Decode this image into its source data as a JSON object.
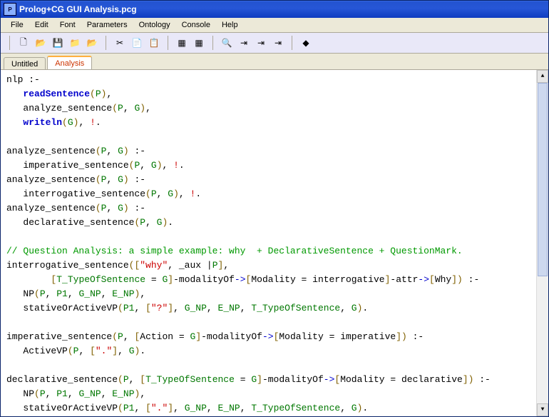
{
  "window": {
    "title": "Prolog+CG GUI Analysis.pcg",
    "app_icon_text": "P"
  },
  "menu": {
    "items": [
      "File",
      "Edit",
      "Font",
      "Parameters",
      "Ontology",
      "Console",
      "Help"
    ]
  },
  "toolbar": {
    "icons": [
      {
        "name": "new-file-icon",
        "glyph": "🗋"
      },
      {
        "name": "open-file-icon",
        "glyph": "📂"
      },
      {
        "name": "save-icon",
        "glyph": "💾"
      },
      {
        "name": "folder-plus-icon",
        "glyph": "📁"
      },
      {
        "name": "folder-open-icon",
        "glyph": "📂"
      },
      {
        "name": "sep"
      },
      {
        "name": "cut-icon",
        "glyph": "✂"
      },
      {
        "name": "copy-icon",
        "glyph": "📄"
      },
      {
        "name": "paste-icon",
        "glyph": "📋"
      },
      {
        "name": "sep"
      },
      {
        "name": "run-1-icon",
        "glyph": "▦"
      },
      {
        "name": "run-2-icon",
        "glyph": "▦"
      },
      {
        "name": "sep"
      },
      {
        "name": "find-icon",
        "glyph": "🔍"
      },
      {
        "name": "step-1-icon",
        "glyph": "⇥"
      },
      {
        "name": "step-2-icon",
        "glyph": "⇥"
      },
      {
        "name": "step-3-icon",
        "glyph": "⇥"
      },
      {
        "name": "sep"
      },
      {
        "name": "help-icon",
        "glyph": "◆"
      }
    ]
  },
  "tabs": {
    "items": [
      {
        "label": "Untitled",
        "active": false
      },
      {
        "label": "Analysis",
        "active": true
      }
    ]
  },
  "code": {
    "lines": [
      [
        {
          "t": "nlp :-",
          "c": "plain"
        }
      ],
      [
        {
          "t": "   ",
          "c": "plain"
        },
        {
          "t": "readSentence",
          "c": "kw"
        },
        {
          "t": "(",
          "c": "punc"
        },
        {
          "t": "P",
          "c": "var"
        },
        {
          "t": ")",
          "c": "punc"
        },
        {
          "t": ",",
          "c": "plain"
        }
      ],
      [
        {
          "t": "   analyze_sentence",
          "c": "plain"
        },
        {
          "t": "(",
          "c": "punc"
        },
        {
          "t": "P",
          "c": "var"
        },
        {
          "t": ", ",
          "c": "plain"
        },
        {
          "t": "G",
          "c": "var"
        },
        {
          "t": ")",
          "c": "punc"
        },
        {
          "t": ",",
          "c": "plain"
        }
      ],
      [
        {
          "t": "   ",
          "c": "plain"
        },
        {
          "t": "writeln",
          "c": "kw"
        },
        {
          "t": "(",
          "c": "punc"
        },
        {
          "t": "G",
          "c": "var"
        },
        {
          "t": ")",
          "c": "punc"
        },
        {
          "t": ", ",
          "c": "plain"
        },
        {
          "t": "!",
          "c": "str"
        },
        {
          "t": ".",
          "c": "plain"
        }
      ],
      [
        {
          "t": "",
          "c": "plain"
        }
      ],
      [
        {
          "t": "analyze_sentence",
          "c": "plain"
        },
        {
          "t": "(",
          "c": "punc"
        },
        {
          "t": "P",
          "c": "var"
        },
        {
          "t": ", ",
          "c": "plain"
        },
        {
          "t": "G",
          "c": "var"
        },
        {
          "t": ")",
          "c": "punc"
        },
        {
          "t": " :-",
          "c": "plain"
        }
      ],
      [
        {
          "t": "   imperative_sentence",
          "c": "plain"
        },
        {
          "t": "(",
          "c": "punc"
        },
        {
          "t": "P",
          "c": "var"
        },
        {
          "t": ", ",
          "c": "plain"
        },
        {
          "t": "G",
          "c": "var"
        },
        {
          "t": ")",
          "c": "punc"
        },
        {
          "t": ", ",
          "c": "plain"
        },
        {
          "t": "!",
          "c": "str"
        },
        {
          "t": ".",
          "c": "plain"
        }
      ],
      [
        {
          "t": "analyze_sentence",
          "c": "plain"
        },
        {
          "t": "(",
          "c": "punc"
        },
        {
          "t": "P",
          "c": "var"
        },
        {
          "t": ", ",
          "c": "plain"
        },
        {
          "t": "G",
          "c": "var"
        },
        {
          "t": ")",
          "c": "punc"
        },
        {
          "t": " :-",
          "c": "plain"
        }
      ],
      [
        {
          "t": "   interrogative_sentence",
          "c": "plain"
        },
        {
          "t": "(",
          "c": "punc"
        },
        {
          "t": "P",
          "c": "var"
        },
        {
          "t": ", ",
          "c": "plain"
        },
        {
          "t": "G",
          "c": "var"
        },
        {
          "t": ")",
          "c": "punc"
        },
        {
          "t": ", ",
          "c": "plain"
        },
        {
          "t": "!",
          "c": "str"
        },
        {
          "t": ".",
          "c": "plain"
        }
      ],
      [
        {
          "t": "analyze_sentence",
          "c": "plain"
        },
        {
          "t": "(",
          "c": "punc"
        },
        {
          "t": "P",
          "c": "var"
        },
        {
          "t": ", ",
          "c": "plain"
        },
        {
          "t": "G",
          "c": "var"
        },
        {
          "t": ")",
          "c": "punc"
        },
        {
          "t": " :-",
          "c": "plain"
        }
      ],
      [
        {
          "t": "   declarative_sentence",
          "c": "plain"
        },
        {
          "t": "(",
          "c": "punc"
        },
        {
          "t": "P",
          "c": "var"
        },
        {
          "t": ", ",
          "c": "plain"
        },
        {
          "t": "G",
          "c": "var"
        },
        {
          "t": ")",
          "c": "punc"
        },
        {
          "t": ".",
          "c": "plain"
        }
      ],
      [
        {
          "t": "",
          "c": "plain"
        }
      ],
      [
        {
          "t": "// Question Analysis: a simple example: why  + DeclarativeSentence + QuestionMark.",
          "c": "cmt"
        }
      ],
      [
        {
          "t": "interrogative_sentence",
          "c": "plain"
        },
        {
          "t": "([",
          "c": "punc"
        },
        {
          "t": "\"why\"",
          "c": "str"
        },
        {
          "t": ", _aux |",
          "c": "plain"
        },
        {
          "t": "P",
          "c": "var"
        },
        {
          "t": "]",
          "c": "punc"
        },
        {
          "t": ",",
          "c": "plain"
        }
      ],
      [
        {
          "t": "        ",
          "c": "plain"
        },
        {
          "t": "[",
          "c": "punc"
        },
        {
          "t": "T_TypeOfSentence",
          "c": "var"
        },
        {
          "t": " = ",
          "c": "plain"
        },
        {
          "t": "G",
          "c": "var"
        },
        {
          "t": "]",
          "c": "punc"
        },
        {
          "t": "-modalityOf",
          "c": "plain"
        },
        {
          "t": "->",
          "c": "sym"
        },
        {
          "t": "[",
          "c": "punc"
        },
        {
          "t": "Modality = interrogative",
          "c": "plain"
        },
        {
          "t": "]",
          "c": "punc"
        },
        {
          "t": "-attr",
          "c": "plain"
        },
        {
          "t": "->",
          "c": "sym"
        },
        {
          "t": "[",
          "c": "punc"
        },
        {
          "t": "Why",
          "c": "plain"
        },
        {
          "t": "]",
          "c": "punc"
        },
        {
          "t": ")",
          "c": "punc"
        },
        {
          "t": " :-",
          "c": "plain"
        }
      ],
      [
        {
          "t": "   NP",
          "c": "plain"
        },
        {
          "t": "(",
          "c": "punc"
        },
        {
          "t": "P",
          "c": "var"
        },
        {
          "t": ", ",
          "c": "plain"
        },
        {
          "t": "P1",
          "c": "var"
        },
        {
          "t": ", ",
          "c": "plain"
        },
        {
          "t": "G_NP",
          "c": "var"
        },
        {
          "t": ", ",
          "c": "plain"
        },
        {
          "t": "E_NP",
          "c": "var"
        },
        {
          "t": ")",
          "c": "punc"
        },
        {
          "t": ",",
          "c": "plain"
        }
      ],
      [
        {
          "t": "   stativeOrActiveVP",
          "c": "plain"
        },
        {
          "t": "(",
          "c": "punc"
        },
        {
          "t": "P1",
          "c": "var"
        },
        {
          "t": ", ",
          "c": "plain"
        },
        {
          "t": "[",
          "c": "punc"
        },
        {
          "t": "\"?\"",
          "c": "str"
        },
        {
          "t": "]",
          "c": "punc"
        },
        {
          "t": ", ",
          "c": "plain"
        },
        {
          "t": "G_NP",
          "c": "var"
        },
        {
          "t": ", ",
          "c": "plain"
        },
        {
          "t": "E_NP",
          "c": "var"
        },
        {
          "t": ", ",
          "c": "plain"
        },
        {
          "t": "T_TypeOfSentence",
          "c": "var"
        },
        {
          "t": ", ",
          "c": "plain"
        },
        {
          "t": "G",
          "c": "var"
        },
        {
          "t": ")",
          "c": "punc"
        },
        {
          "t": ".",
          "c": "plain"
        }
      ],
      [
        {
          "t": "",
          "c": "plain"
        }
      ],
      [
        {
          "t": "imperative_sentence",
          "c": "plain"
        },
        {
          "t": "(",
          "c": "punc"
        },
        {
          "t": "P",
          "c": "var"
        },
        {
          "t": ", ",
          "c": "plain"
        },
        {
          "t": "[",
          "c": "punc"
        },
        {
          "t": "Action = ",
          "c": "plain"
        },
        {
          "t": "G",
          "c": "var"
        },
        {
          "t": "]",
          "c": "punc"
        },
        {
          "t": "-modalityOf",
          "c": "plain"
        },
        {
          "t": "->",
          "c": "sym"
        },
        {
          "t": "[",
          "c": "punc"
        },
        {
          "t": "Modality = imperative",
          "c": "plain"
        },
        {
          "t": "]",
          "c": "punc"
        },
        {
          "t": ")",
          "c": "punc"
        },
        {
          "t": " :-",
          "c": "plain"
        }
      ],
      [
        {
          "t": "   ActiveVP",
          "c": "plain"
        },
        {
          "t": "(",
          "c": "punc"
        },
        {
          "t": "P",
          "c": "var"
        },
        {
          "t": ", ",
          "c": "plain"
        },
        {
          "t": "[",
          "c": "punc"
        },
        {
          "t": "\".\"",
          "c": "str"
        },
        {
          "t": "]",
          "c": "punc"
        },
        {
          "t": ", ",
          "c": "plain"
        },
        {
          "t": "G",
          "c": "var"
        },
        {
          "t": ")",
          "c": "punc"
        },
        {
          "t": ".",
          "c": "plain"
        }
      ],
      [
        {
          "t": "",
          "c": "plain"
        }
      ],
      [
        {
          "t": "declarative_sentence",
          "c": "plain"
        },
        {
          "t": "(",
          "c": "punc"
        },
        {
          "t": "P",
          "c": "var"
        },
        {
          "t": ", ",
          "c": "plain"
        },
        {
          "t": "[",
          "c": "punc"
        },
        {
          "t": "T_TypeOfSentence",
          "c": "var"
        },
        {
          "t": " = ",
          "c": "plain"
        },
        {
          "t": "G",
          "c": "var"
        },
        {
          "t": "]",
          "c": "punc"
        },
        {
          "t": "-modalityOf",
          "c": "plain"
        },
        {
          "t": "->",
          "c": "sym"
        },
        {
          "t": "[",
          "c": "punc"
        },
        {
          "t": "Modality = declarative",
          "c": "plain"
        },
        {
          "t": "]",
          "c": "punc"
        },
        {
          "t": ")",
          "c": "punc"
        },
        {
          "t": " :-",
          "c": "plain"
        }
      ],
      [
        {
          "t": "   NP",
          "c": "plain"
        },
        {
          "t": "(",
          "c": "punc"
        },
        {
          "t": "P",
          "c": "var"
        },
        {
          "t": ", ",
          "c": "plain"
        },
        {
          "t": "P1",
          "c": "var"
        },
        {
          "t": ", ",
          "c": "plain"
        },
        {
          "t": "G_NP",
          "c": "var"
        },
        {
          "t": ", ",
          "c": "plain"
        },
        {
          "t": "E_NP",
          "c": "var"
        },
        {
          "t": ")",
          "c": "punc"
        },
        {
          "t": ",",
          "c": "plain"
        }
      ],
      [
        {
          "t": "   stativeOrActiveVP",
          "c": "plain"
        },
        {
          "t": "(",
          "c": "punc"
        },
        {
          "t": "P1",
          "c": "var"
        },
        {
          "t": ", ",
          "c": "plain"
        },
        {
          "t": "[",
          "c": "punc"
        },
        {
          "t": "\".\"",
          "c": "str"
        },
        {
          "t": "]",
          "c": "punc"
        },
        {
          "t": ", ",
          "c": "plain"
        },
        {
          "t": "G_NP",
          "c": "var"
        },
        {
          "t": ", ",
          "c": "plain"
        },
        {
          "t": "E_NP",
          "c": "var"
        },
        {
          "t": ", ",
          "c": "plain"
        },
        {
          "t": "T_TypeOfSentence",
          "c": "var"
        },
        {
          "t": ", ",
          "c": "plain"
        },
        {
          "t": "G",
          "c": "var"
        },
        {
          "t": ")",
          "c": "punc"
        },
        {
          "t": ".",
          "c": "plain"
        }
      ]
    ]
  }
}
